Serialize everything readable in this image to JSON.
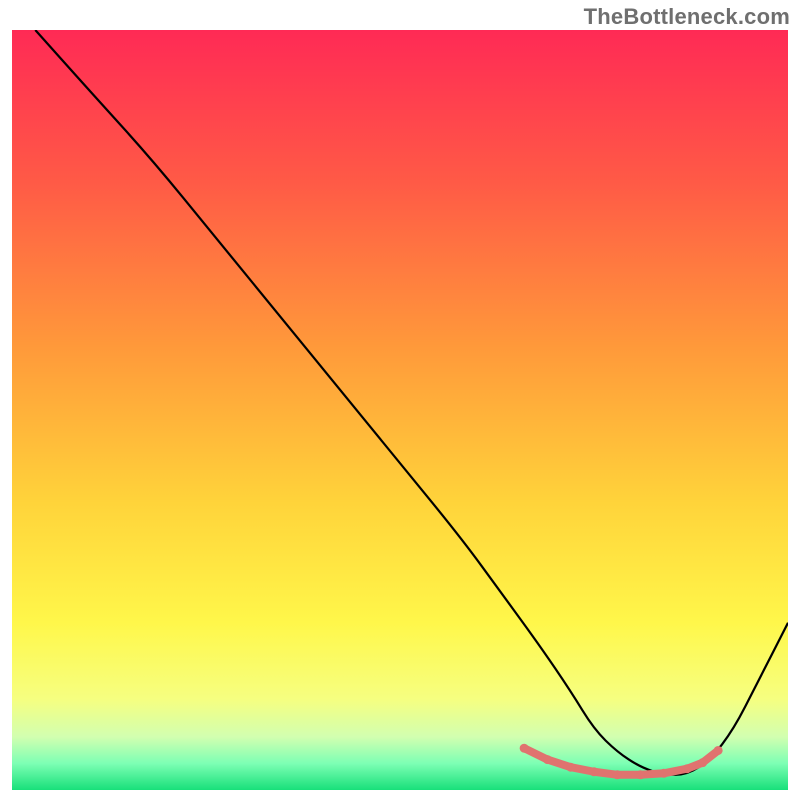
{
  "watermark": "TheBottleneck.com",
  "chart_data": {
    "type": "line",
    "title": "",
    "xlabel": "",
    "ylabel": "",
    "xlim": [
      0,
      100
    ],
    "ylim": [
      0,
      100
    ],
    "axes_visible": false,
    "grid": false,
    "gradient_background": {
      "stops": [
        {
          "offset": 0.0,
          "color": "#ff2a55"
        },
        {
          "offset": 0.2,
          "color": "#ff5a46"
        },
        {
          "offset": 0.42,
          "color": "#ff9a3a"
        },
        {
          "offset": 0.62,
          "color": "#ffd33a"
        },
        {
          "offset": 0.78,
          "color": "#fff74a"
        },
        {
          "offset": 0.88,
          "color": "#f6ff80"
        },
        {
          "offset": 0.93,
          "color": "#d2ffb0"
        },
        {
          "offset": 0.965,
          "color": "#7dffb4"
        },
        {
          "offset": 1.0,
          "color": "#18e07a"
        }
      ]
    },
    "series": [
      {
        "name": "bottleneck-curve",
        "color": "#000000",
        "width": 2.2,
        "x": [
          3,
          10,
          18,
          26,
          34,
          42,
          50,
          58,
          63,
          68,
          72,
          75,
          78,
          81,
          84,
          87,
          90,
          93,
          96,
          100
        ],
        "y": [
          100,
          92,
          83,
          73,
          63,
          53,
          43,
          33,
          26,
          19,
          13,
          8,
          5,
          3,
          2,
          2,
          4,
          8,
          14,
          22
        ]
      }
    ],
    "highlight_band": {
      "name": "optimal-range",
      "color": "#e0736f",
      "dot_radius": 4.5,
      "line_width": 8,
      "points_x": [
        66,
        69,
        72,
        75,
        78,
        81,
        84,
        87,
        89,
        91
      ],
      "points_y": [
        5.5,
        4.0,
        3.0,
        2.4,
        2.0,
        2.0,
        2.2,
        2.8,
        3.6,
        5.2
      ]
    }
  }
}
